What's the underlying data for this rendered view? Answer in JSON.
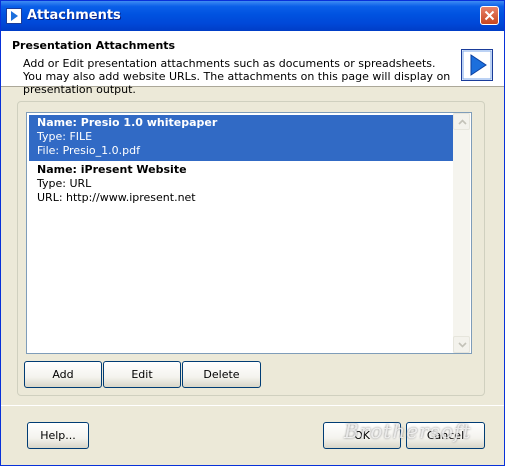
{
  "window": {
    "title": "Attachments"
  },
  "header": {
    "title": "Presentation Attachments",
    "description": "Add or Edit presentation attachments such as documents or spreadsheets.  You may also add website URLs.  The attachments on this page will display on presentation output."
  },
  "attachments": [
    {
      "name_label": "Name:  Presio 1.0 whitepaper",
      "type_label": "Type:  FILE",
      "detail_label": "File:  Presio_1.0.pdf",
      "selected": true
    },
    {
      "name_label": "Name:  iPresent Website",
      "type_label": "Type:  URL",
      "detail_label": "URL:  http://www.ipresent.net",
      "selected": false
    }
  ],
  "list_buttons": {
    "add": "Add",
    "edit": "Edit",
    "delete": "Delete"
  },
  "footer": {
    "help": "Help...",
    "ok": "OK",
    "cancel": "Cancel"
  },
  "watermark": "Brothersoft",
  "colors": {
    "titlebar": "#0052e0",
    "selection": "#316ac5",
    "dialog_bg": "#ece9d8",
    "next_arrow": "#1c6fdc"
  },
  "icons": {
    "app": "app-icon",
    "close": "close-icon",
    "next": "arrow-right-icon"
  }
}
